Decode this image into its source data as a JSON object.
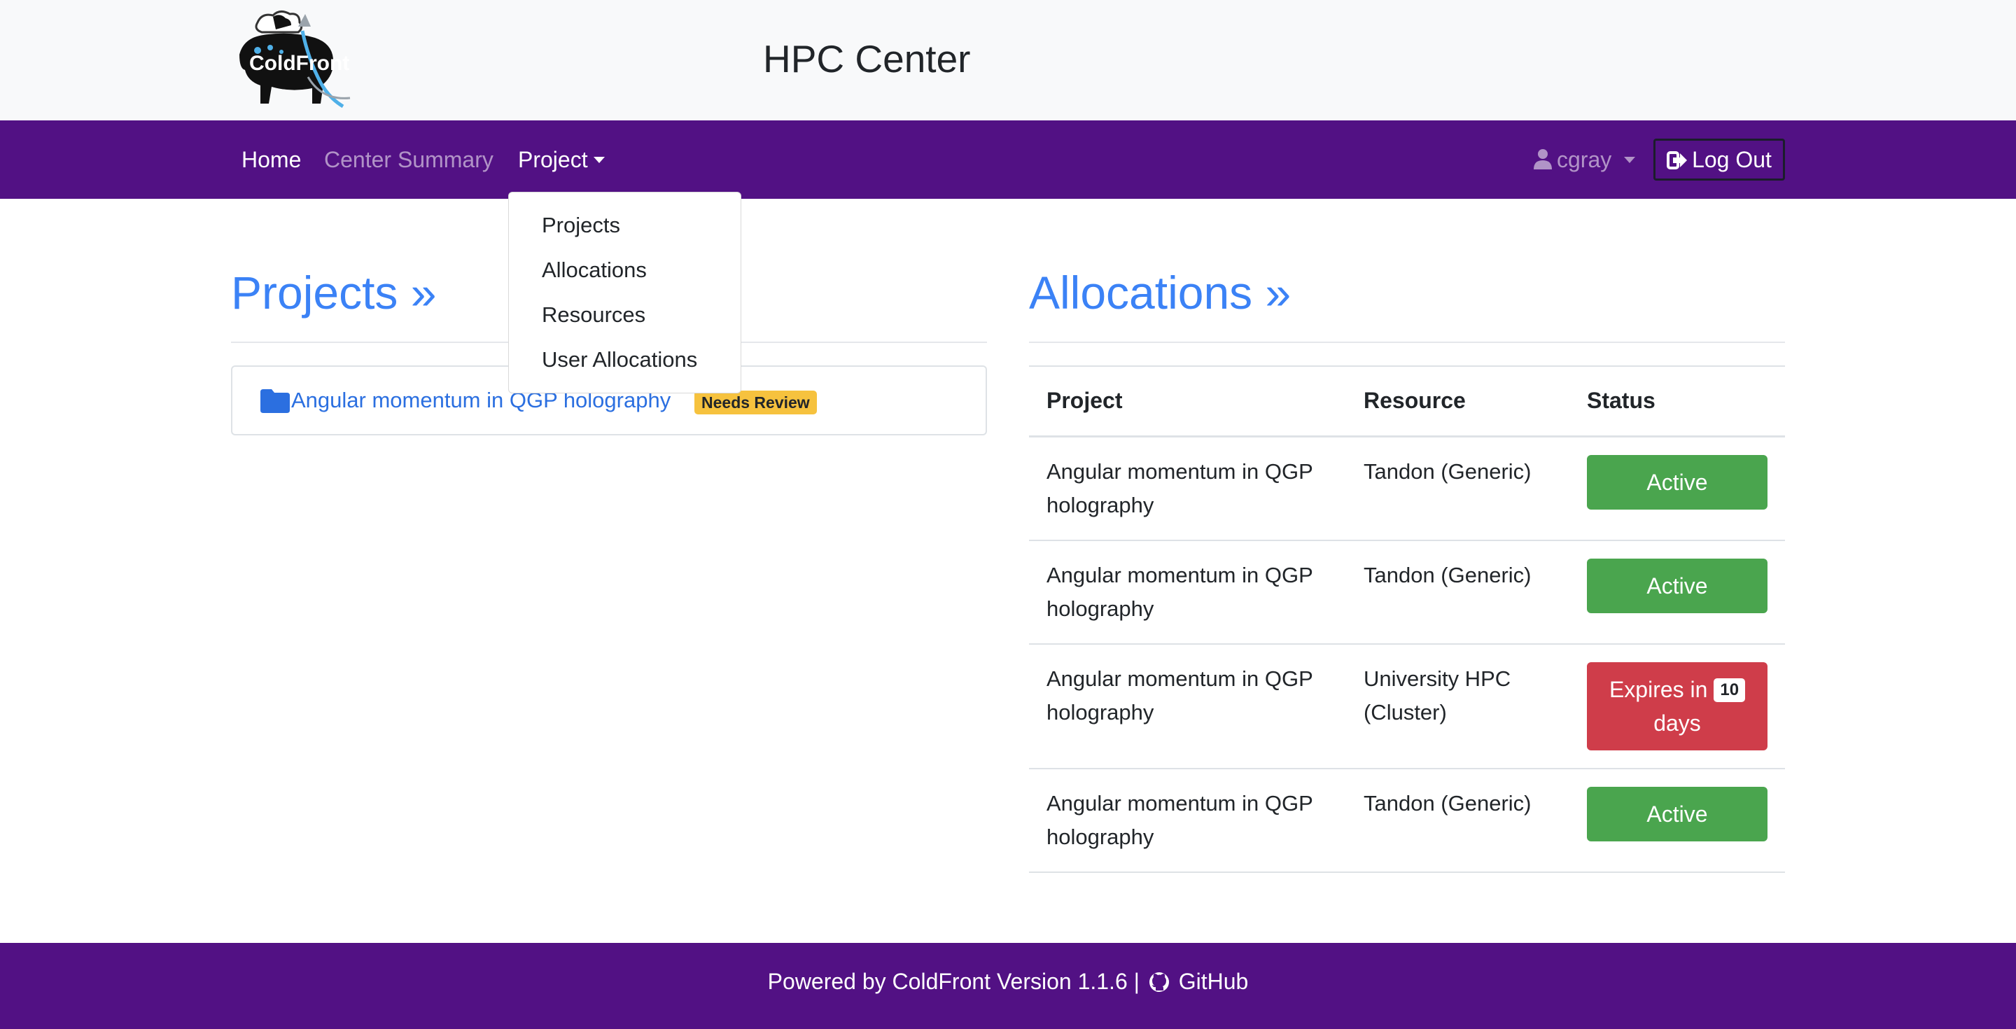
{
  "header": {
    "logo_text": "ColdFront",
    "site_title": "HPC Center"
  },
  "navbar": {
    "home": "Home",
    "center_summary": "Center Summary",
    "project": "Project",
    "username": "cgray",
    "logout": "Log Out",
    "colors": {
      "background": "#521184"
    }
  },
  "project_menu": {
    "items": [
      "Projects",
      "Allocations",
      "Resources",
      "User Allocations"
    ]
  },
  "projects": {
    "heading": "Projects »",
    "items": [
      {
        "title": "Angular momentum in QGP holography",
        "badge": "Needs Review"
      }
    ]
  },
  "allocations": {
    "heading": "Allocations »",
    "columns": [
      "Project",
      "Resource",
      "Status"
    ],
    "rows": [
      {
        "project": "Angular momentum in QGP holography",
        "resource": "Tandon (Generic)",
        "status": "Active"
      },
      {
        "project": "Angular momentum in QGP holography",
        "resource": "Tandon (Generic)",
        "status": "Active"
      },
      {
        "project": "Angular momentum in QGP holography",
        "resource": "University HPC (Cluster)",
        "status_prefix": "Expires in",
        "status_days": "10",
        "status_suffix": "days"
      },
      {
        "project": "Angular momentum in QGP holography",
        "resource": "Tandon (Generic)",
        "status": "Active"
      }
    ],
    "colors": {
      "active": "#4aa54e",
      "expiring": "#cf3d4a"
    }
  },
  "footer": {
    "text": "Powered by ColdFront Version 1.1.6 |",
    "github": "GitHub"
  }
}
